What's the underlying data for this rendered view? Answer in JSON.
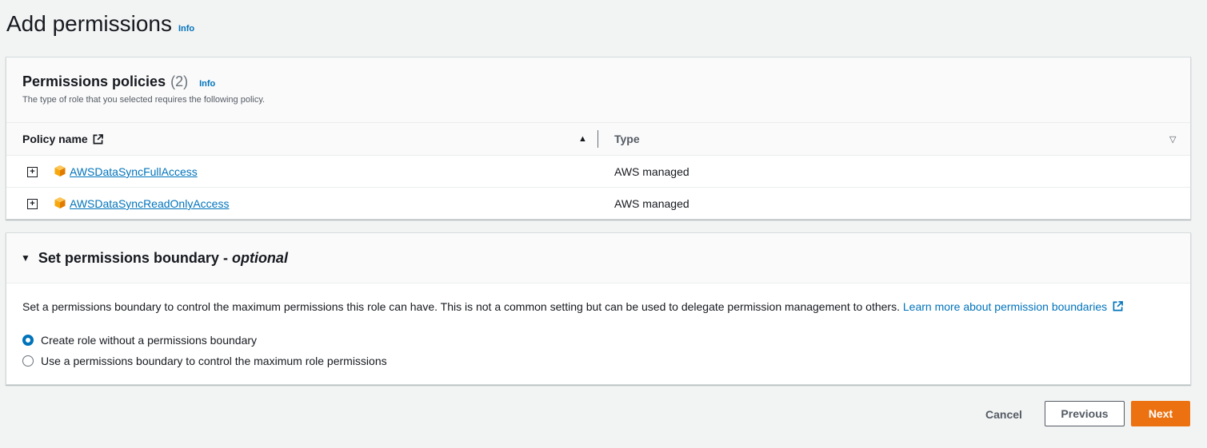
{
  "page": {
    "title": "Add permissions",
    "info": "Info"
  },
  "policies": {
    "title": "Permissions policies",
    "count": "(2)",
    "info": "Info",
    "description": "The type of role that you selected requires the following policy.",
    "columns": {
      "name": "Policy name",
      "type": "Type"
    },
    "rows": [
      {
        "name": "AWSDataSyncFullAccess",
        "type": "AWS managed"
      },
      {
        "name": "AWSDataSyncReadOnlyAccess",
        "type": "AWS managed"
      }
    ]
  },
  "boundary": {
    "title": "Set permissions boundary - ",
    "title_optional": "optional",
    "description": "Set a permissions boundary to control the maximum permissions this role can have. This is not a common setting but can be used to delegate permission management to others.",
    "learn_more": "Learn more about permission boundaries",
    "options": [
      {
        "label": "Create role without a permissions boundary",
        "selected": true
      },
      {
        "label": "Use a permissions boundary to control the maximum role permissions",
        "selected": false
      }
    ]
  },
  "footer": {
    "cancel": "Cancel",
    "previous": "Previous",
    "next": "Next"
  },
  "colors": {
    "link": "#0073bb",
    "primary_button": "#ec7211",
    "page_background": "#f2f3f3"
  },
  "icons": {
    "external": "external-link-icon",
    "expand": "expand-plus-icon",
    "policy": "aws-managed-cube-icon",
    "sort_asc": "sort-ascending-icon",
    "sort_desc": "sort-descending-icon",
    "caret": "caret-down-icon"
  }
}
